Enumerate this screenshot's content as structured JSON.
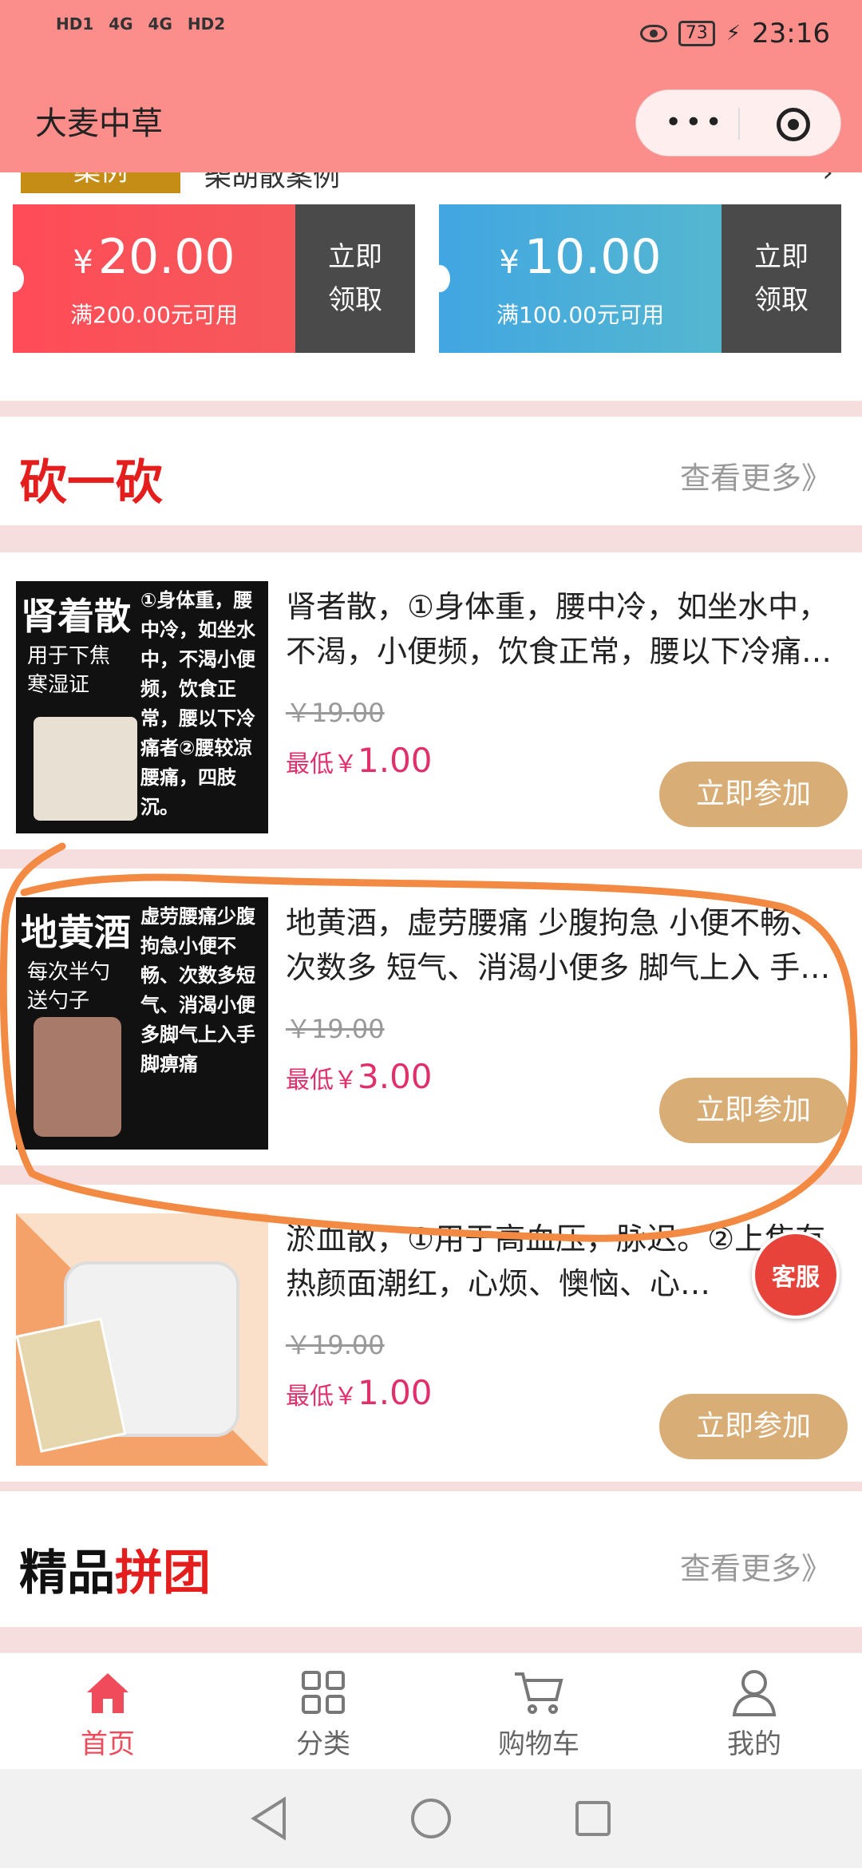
{
  "status": {
    "left_labels": [
      "HD1",
      "4G",
      "4G",
      "HD2"
    ],
    "battery": "73",
    "time": "23:16"
  },
  "header": {
    "title": "大麦中草",
    "more": "•••"
  },
  "promo_strip": {
    "tag": "案例",
    "text": "柴胡散案例",
    "arrow": "›"
  },
  "coupons": [
    {
      "currency": "¥",
      "amount": "20.00",
      "condition": "满200.00元可用",
      "btn_line1": "立即",
      "btn_line2": "领取"
    },
    {
      "currency": "¥",
      "amount": "10.00",
      "condition": "满100.00元可用",
      "btn_line1": "立即",
      "btn_line2": "领取"
    }
  ],
  "bargain": {
    "title": "砍一砍",
    "more": "查看更多》",
    "items": [
      {
        "name": "肾者散，①身体重，腰中冷，如坐水中，不渴，小便频，饮食正常，腰以下冷痛…",
        "old_price": "￥19.00",
        "low_label": "最低￥",
        "low_price": "1.00",
        "button": "立即参加",
        "thumb_title": "肾着散",
        "thumb_sub": "用于下焦寒湿证",
        "thumb_desc": "①身体重，腰中冷，如坐水中，不渴小便频，饮食正常，腰以下冷痛者②腰较凉腰痛，四肢沉。"
      },
      {
        "name": "地黄酒，虚劳腰痛 少腹拘急 小便不畅、次数多 短气、消渴小便多 脚气上入 手…",
        "old_price": "￥19.00",
        "low_label": "最低￥",
        "low_price": "3.00",
        "button": "立即参加",
        "thumb_title": "地黄酒",
        "thumb_sub": "每次半勺送勺子",
        "thumb_desc": "虚劳腰痛少腹拘急小便不畅、次数多短气、消渴小便多脚气上入手脚痹痛"
      },
      {
        "name": "淤血散，①用于高血压，脉迟。②上焦有热颜面潮红，心烦、懊恼、心…",
        "old_price": "￥19.00",
        "low_label": "最低￥",
        "low_price": "1.00",
        "button": "立即参加"
      }
    ]
  },
  "group": {
    "title_part1": "精品",
    "title_part2": "拼团",
    "more": "查看更多》"
  },
  "service": "客服",
  "tabbar": [
    {
      "label": "首页",
      "icon": "home-icon"
    },
    {
      "label": "分类",
      "icon": "category-icon"
    },
    {
      "label": "购物车",
      "icon": "cart-icon"
    },
    {
      "label": "我的",
      "icon": "user-icon"
    }
  ],
  "colors": {
    "header": "#fb8d8b",
    "active_tab": "#f04b5a",
    "join_button": "#d8ae76",
    "price": "#e0306a"
  }
}
